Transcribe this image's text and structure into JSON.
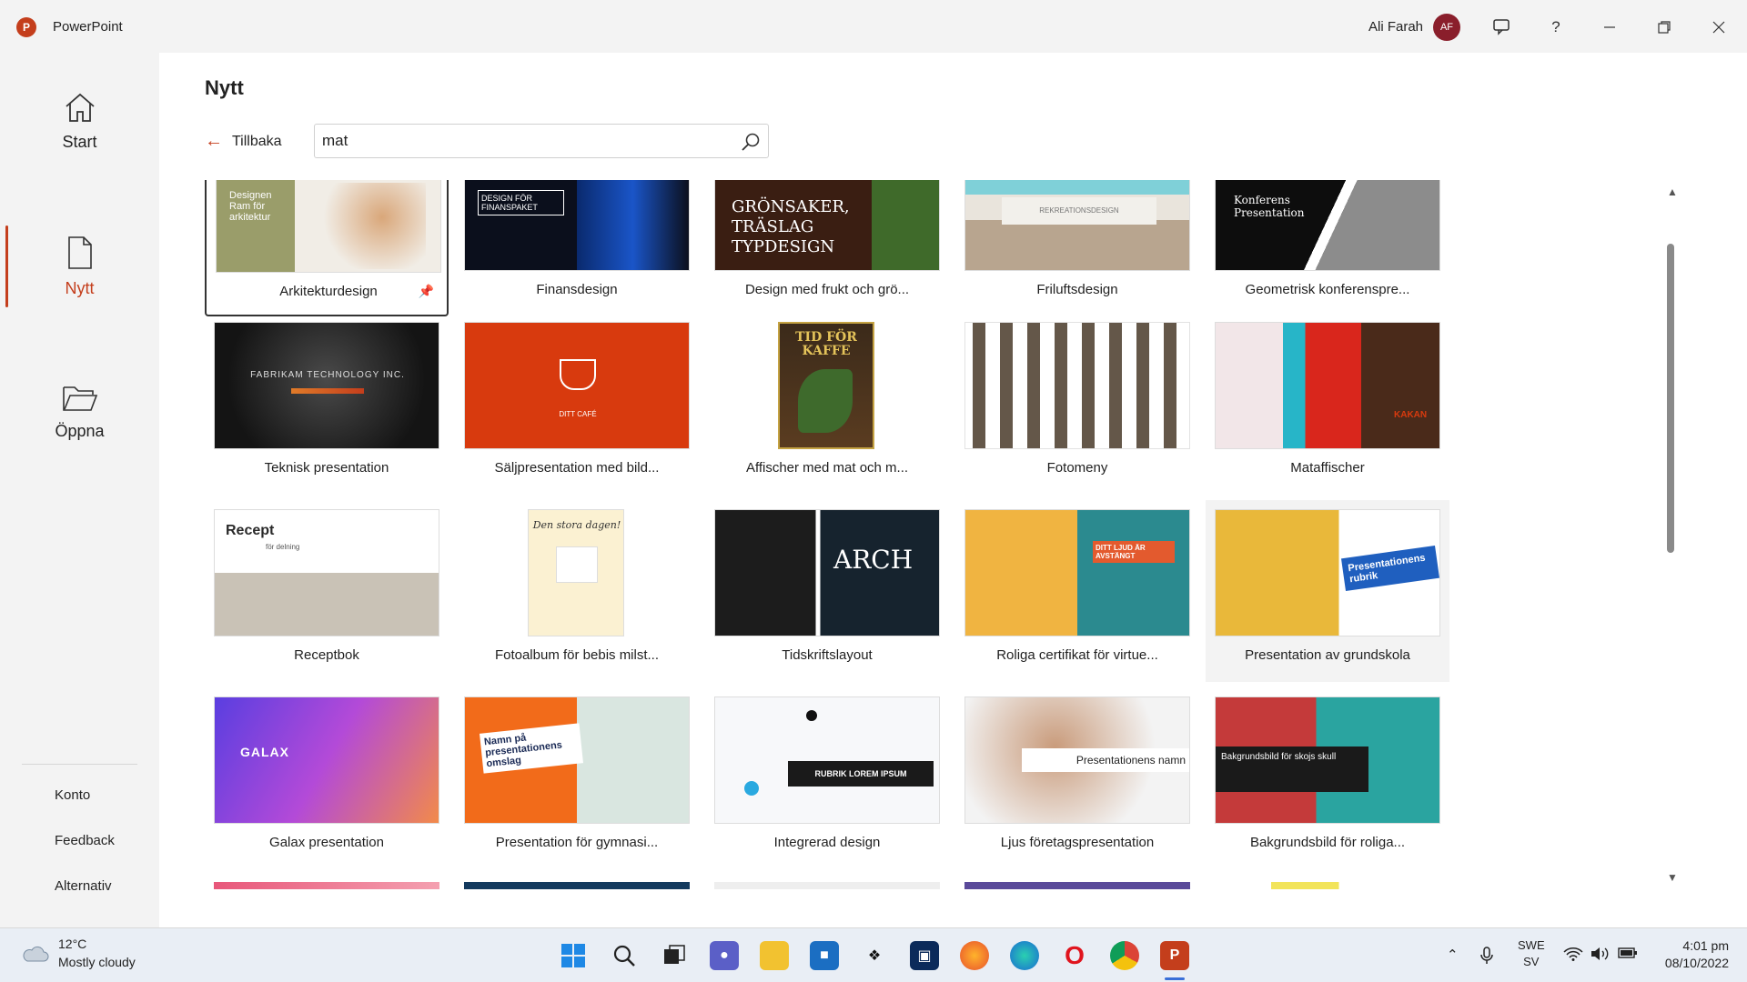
{
  "titlebar": {
    "app_name": "PowerPoint",
    "user_name": "Ali Farah",
    "avatar_initials": "AF",
    "help": "?"
  },
  "nav": {
    "start": "Start",
    "new": "Nytt",
    "open": "Öppna",
    "account": "Konto",
    "feedback": "Feedback",
    "options": "Alternativ"
  },
  "main": {
    "title": "Nytt",
    "back_label": "Tillbaka",
    "search_value": "mat"
  },
  "templates": [
    {
      "label": "Arkitekturdesign",
      "thumb_text": "Designen Ram för arkitektur"
    },
    {
      "label": "Finansdesign",
      "thumb_text": "DESIGN FÖR FINANSPAKET"
    },
    {
      "label": "Design med frukt och grö...",
      "thumb_text": "GRÖNSAKER, TRÄSLAG TYPDESIGN"
    },
    {
      "label": "Friluftsdesign",
      "thumb_text": "REKREATIONSDESIGN"
    },
    {
      "label": "Geometrisk konferenspre...",
      "thumb_text": "Konferens Presentation"
    },
    {
      "label": "Teknisk presentation",
      "thumb_text": "FABRIKAM TECHNOLOGY INC."
    },
    {
      "label": "Säljpresentation med bild...",
      "thumb_text": "DITT CAFÉ"
    },
    {
      "label": "Affischer med mat och m...",
      "thumb_text": "TID FÖR KAFFE"
    },
    {
      "label": "Fotomeny",
      "thumb_text": ""
    },
    {
      "label": "Mataffischer",
      "thumb_text": "KAKAN"
    },
    {
      "label": "Receptbok",
      "thumb_text": "Recept",
      "thumb_sub": "för delning"
    },
    {
      "label": "Fotoalbum för bebis milst...",
      "thumb_text": "Den stora dagen!"
    },
    {
      "label": "Tidskriftslayout",
      "thumb_text": "ARCH"
    },
    {
      "label": "Roliga certifikat för virtue...",
      "thumb_text": "DITT LJUD ÄR AVSTÄNGT"
    },
    {
      "label": "Presentation av grundskola",
      "thumb_text": "Presentationens rubrik"
    },
    {
      "label": "Galax presentation",
      "thumb_text": "GALAX"
    },
    {
      "label": "Presentation för gymnasi...",
      "thumb_text": "Namn på presentationens omslag"
    },
    {
      "label": "Integrerad design",
      "thumb_text": "RUBRIK LOREM IPSUM"
    },
    {
      "label": "Ljus företagspresentation",
      "thumb_text": "Presentationens namn"
    },
    {
      "label": "Bakgrundsbild för roliga...",
      "thumb_text": "Bakgrundsbild för skojs skull"
    }
  ],
  "taskbar": {
    "temperature": "12°C",
    "weather": "Mostly cloudy",
    "lang_top": "SWE",
    "lang_bottom": "SV",
    "time": "4:01 pm",
    "date": "08/10/2022"
  },
  "colors": {
    "accent": "#c43e1c",
    "nav_bg": "#f3f3f3"
  }
}
